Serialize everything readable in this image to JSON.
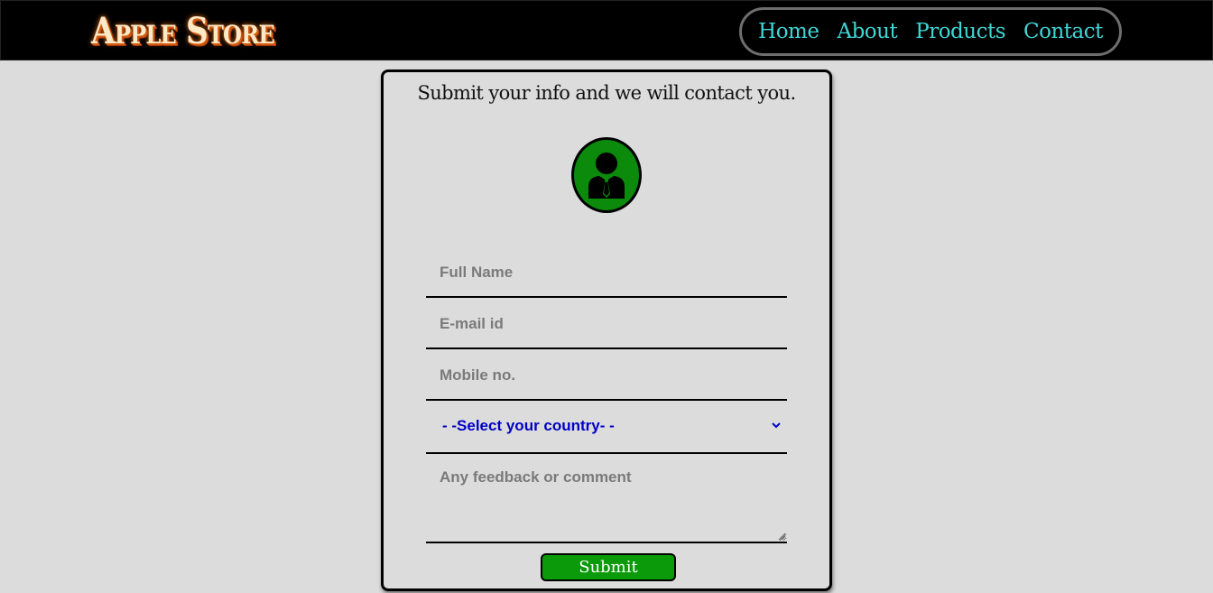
{
  "header": {
    "logo_text": "Apple Store",
    "nav": [
      {
        "label": "Home"
      },
      {
        "label": "About"
      },
      {
        "label": "Products"
      },
      {
        "label": "Contact"
      }
    ]
  },
  "form": {
    "title": "Submit your info and we will contact you.",
    "avatar_icon": "user-tie-icon",
    "full_name_placeholder": "Full Name",
    "email_placeholder": "E-mail id",
    "mobile_placeholder": "Mobile no.",
    "country_select_value": "- -Select your country- -",
    "feedback_placeholder": "Any feedback or comment",
    "submit_label": "Submit"
  },
  "colors": {
    "header_bg": "#000000",
    "page_bg": "#dcdcdc",
    "nav_link": "#3fd6d6",
    "accent_green": "#0a9a0a",
    "select_text": "#0000c8"
  }
}
